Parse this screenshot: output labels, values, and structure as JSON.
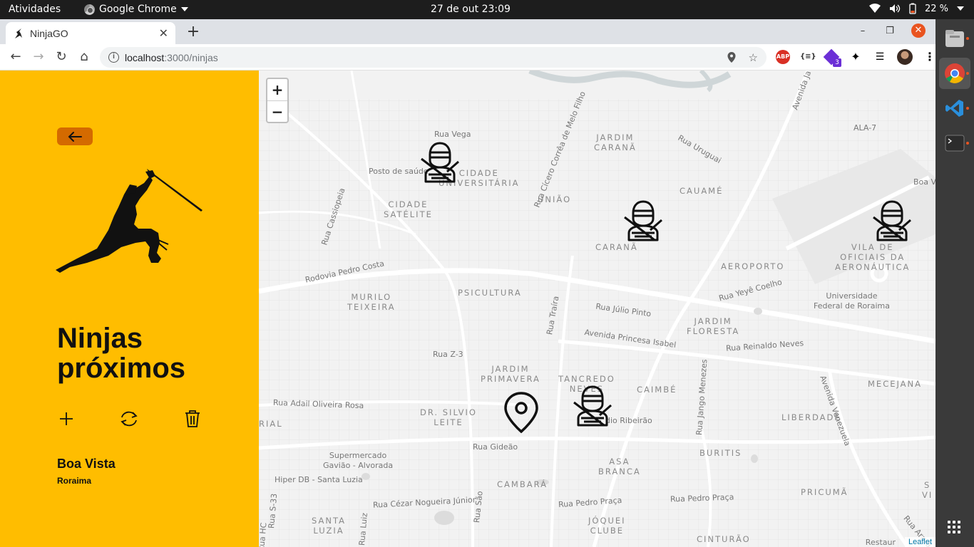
{
  "system": {
    "activities": "Atividades",
    "app_name": "Google Chrome",
    "clock": "27 de out  23:09",
    "battery": "22 %"
  },
  "browser": {
    "tab_title": "NinjaGO",
    "url_host": "localhost",
    "url_path": ":3000/ninjas",
    "extensions": {
      "abp": "ABP",
      "json": "{≡}",
      "badge_count": "3"
    }
  },
  "sidebar": {
    "title": "Ninjas próximos",
    "city": "Boa Vista",
    "state": "Roraima",
    "colors": {
      "background": "#ffbd00",
      "back_button": "#d46a00"
    },
    "actions": [
      "plus-icon",
      "refresh-icon",
      "trash-icon"
    ]
  },
  "map": {
    "zoom_in": "+",
    "zoom_out": "−",
    "attribution": "Leaflet",
    "labels": {
      "jardim_carana": "JARDIM\nCARANÃ",
      "cidade_universitaria": "CIDADE\nUNIVERSITÁRIA",
      "cidade_satelite": "CIDADE\nSATÉLITE",
      "uniao": "UNIÃO",
      "cauame": "CAUAMÉ",
      "carana": "CARANÃ",
      "aeroporto": "AEROPORTO",
      "vila_oficiais": "VILA DE\nOFICIAIS DA\nAERONÁUTICA",
      "murilo_teixeira": "MURILO\nTEIXEIRA",
      "psicultura": "PSICULTURA",
      "jardim_floresta": "JARDIM\nFLORESTA",
      "jardim_primavera": "JARDIM\nPRIMAVERA",
      "tancredo_neves": "TANCREDO\nNEVES",
      "caimbe": "CAIMBÉ",
      "mecejana": "MECEJANA",
      "dr_silvio_leite": "DR. SILVIO\nLEITE",
      "liberdade": "LIBERDADE",
      "buritis": "BURITIS",
      "asa_branca": "ASA\nBRANCA",
      "cambara": "CAMBARÁ",
      "pricuma": "PRICUMÃ",
      "santa_luzia": "SANTA\nLUZIA",
      "joquei_clube": "JÓQUEI\nCLUBE",
      "cinturao": "CINTURÃO",
      "ala7": "ALA-7",
      "boa_vi": "Boa Vi",
      "rua_vega": "Rua Vega",
      "posto_saude": "Posto de saúde",
      "rua_uruguai": "Rua Uruguai",
      "rua_cicero": "Rua Cícero Corrêa de Melo Filho",
      "rua_cassiopeia": "Rua Cassiopeia",
      "rodovia_pedro_costa": "Rodovia Pedro Costa",
      "rua_yeye": "Rua Yeyê Coelho",
      "universidade": "Universidade\nFederal de Roraima",
      "rua_julio": "Rua Júlio Pinto",
      "rua_traira": "Rua Traíra",
      "av_princesa": "Avenida Princesa Isabel",
      "rua_reinaldo": "Rua Reinaldo Neves",
      "rua_z3": "Rua Z-3",
      "rua_jango": "Rua Jango Menezes",
      "av_venezuela": "Avenida Venezuela",
      "rua_adail": "Rua Adail Oliveira Rosa",
      "rial": "RIAL",
      "ribeirao": "dio Ribeirão",
      "supermercado": "Supermercado\nGavião - Alvorada",
      "rua_gideao": "Rua Gideão",
      "hiper_db": "Hiper DB - Santa Luzia",
      "rua_cesar": "Rua Cézar Nogueira Júnior",
      "rua_pedro_praca": "Rua Pedro Praça",
      "rua_pedro_praca2": "Rua Pedro Praça",
      "rua_sao": "Rua São",
      "rua_s33": "Rua S-33",
      "rua_luiz": "Rua Luiz",
      "rua_hc": "Rua HC",
      "av_ja": "Avenida Ja",
      "s_vi": "S\nVI",
      "rua_arara": "Rua Arara",
      "restaur": "Restaur"
    }
  }
}
